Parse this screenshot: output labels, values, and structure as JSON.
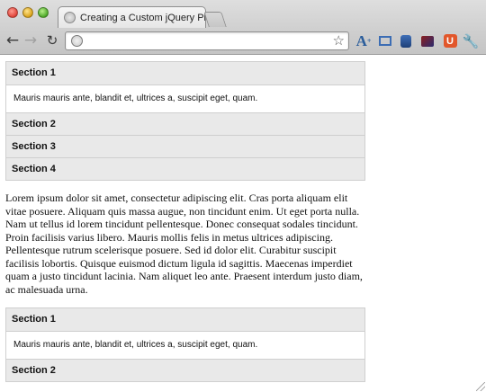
{
  "browser": {
    "tab_title": "Creating a Custom jQuery Pl",
    "address_value": "",
    "extensions": [
      "text-size-extension",
      "frame-extension",
      "profile-extension",
      "card-extension",
      "u-extension"
    ],
    "ext_u_label": "U"
  },
  "accordion_top": {
    "sections": [
      {
        "title": "Section 1",
        "content": "Mauris mauris ante, blandit et, ultrices a, suscipit eget, quam."
      },
      {
        "title": "Section 2"
      },
      {
        "title": "Section 3"
      },
      {
        "title": "Section 4"
      }
    ]
  },
  "paragraph": "Lorem ipsum dolor sit amet, consectetur adipiscing elit. Cras porta aliquam elit vitae posuere. Aliquam quis massa augue, non tincidunt enim. Ut eget porta nulla. Nam ut tellus id lorem tincidunt pellentesque. Donec consequat sodales tincidunt. Proin facilisis varius libero. Mauris mollis felis in metus ultrices adipiscing. Pellentesque rutrum scelerisque posuere. Sed id dolor elit. Curabitur suscipit facilisis lobortis. Quisque euismod dictum ligula id sagittis. Maecenas imperdiet quam a justo tincidunt lacinia. Nam aliquet leo ante. Praesent interdum justo diam, ac malesuada urna.",
  "accordion_bottom": {
    "sections": [
      {
        "title": "Section 1",
        "content": "Mauris mauris ante, blandit et, ultrices a, suscipit eget, quam."
      },
      {
        "title": "Section 2"
      }
    ]
  },
  "colors": {
    "header_bg": "#e9e9e9",
    "border": "#cfcfcf",
    "chrome_top": "#dedede",
    "chrome_bottom": "#c4c4c4"
  }
}
